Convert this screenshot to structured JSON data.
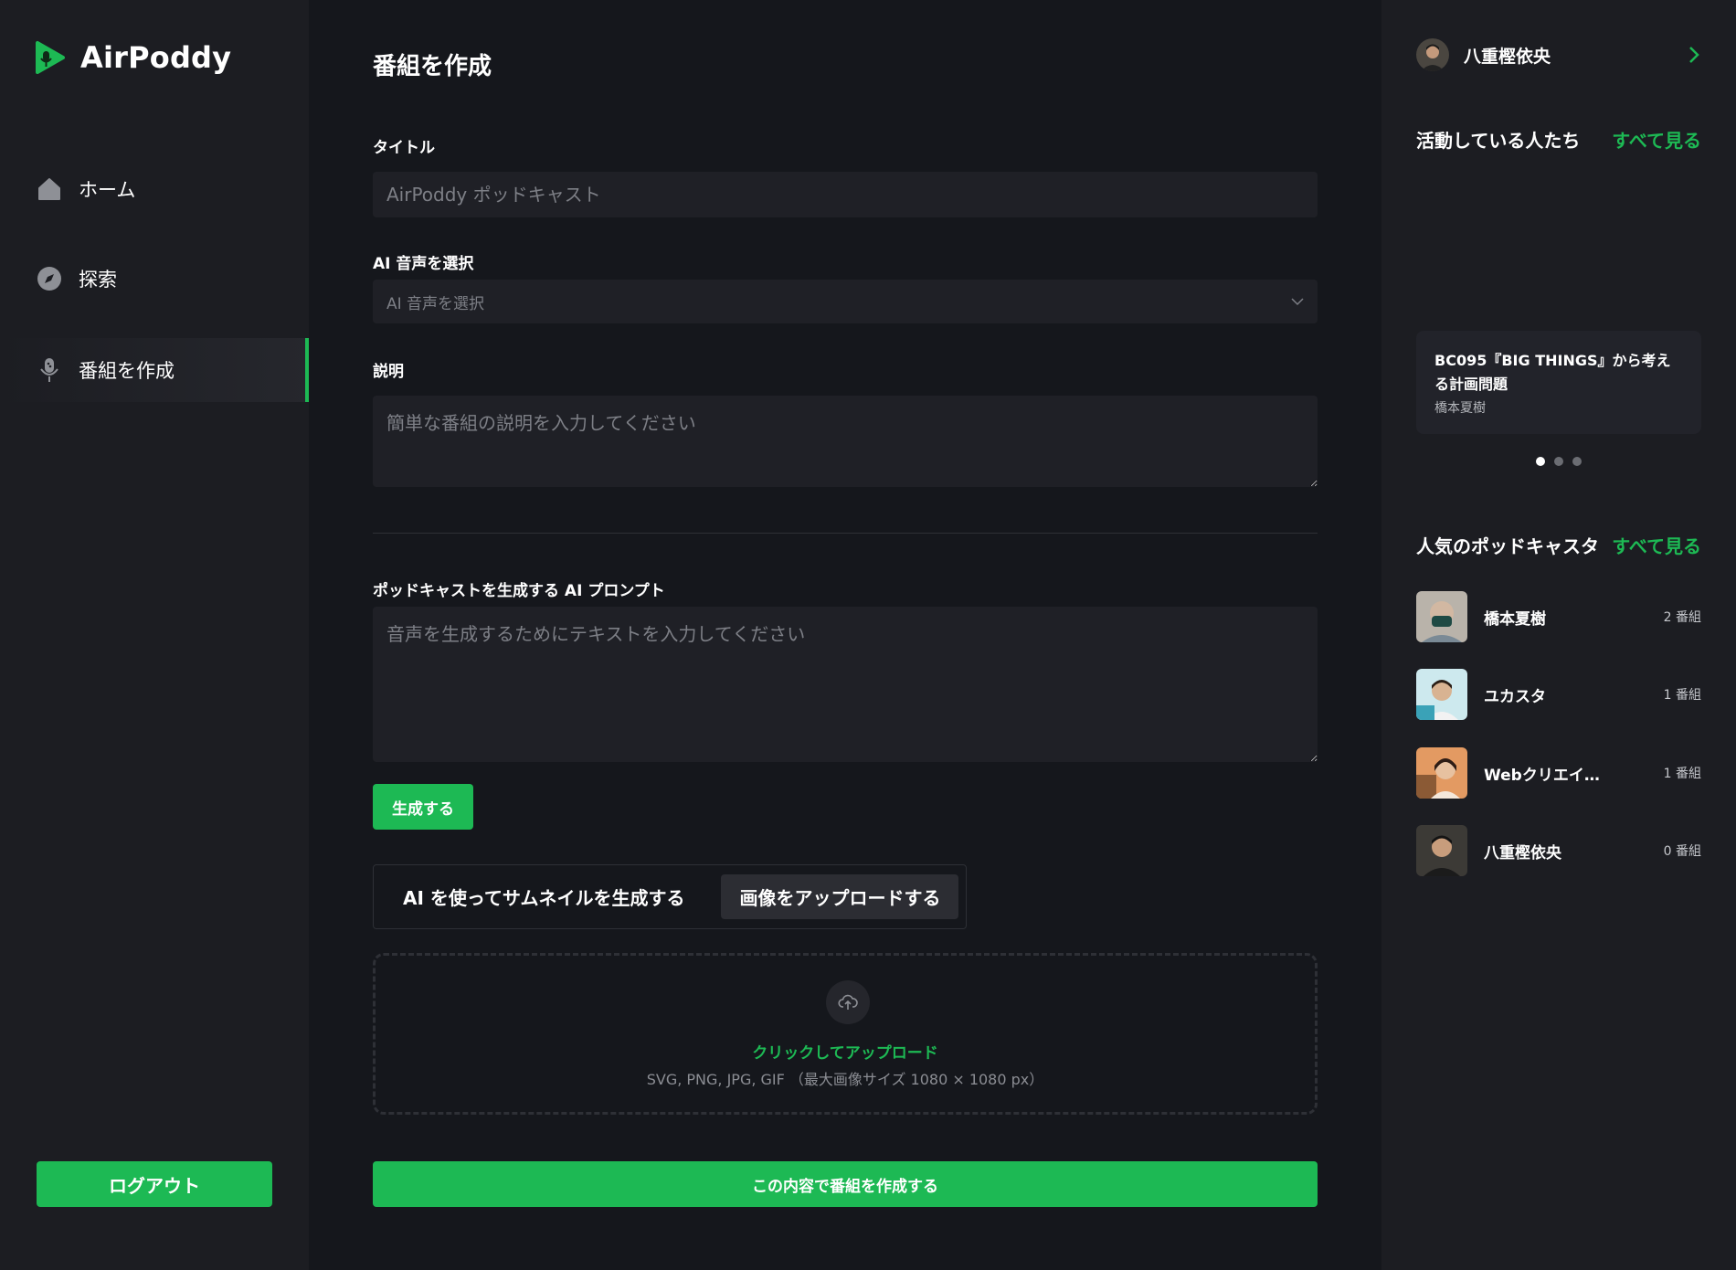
{
  "app": {
    "name": "AirPoddy"
  },
  "colors": {
    "accent": "#1db954",
    "background": "#15171c",
    "sidebar": "#1c1d22",
    "input": "#1f2026"
  },
  "nav": {
    "items": [
      {
        "label": "ホーム",
        "icon": "home-icon",
        "active": false
      },
      {
        "label": "探索",
        "icon": "compass-icon",
        "active": false
      },
      {
        "label": "番組を作成",
        "icon": "microphone-icon",
        "active": true
      }
    ],
    "logout_label": "ログアウト"
  },
  "form": {
    "page_title": "番組を作成",
    "title_label": "タイトル",
    "title_placeholder": "AirPoddy ポッドキャスト",
    "voice_label": "AI 音声を選択",
    "voice_placeholder": "AI 音声を選択",
    "description_label": "説明",
    "description_placeholder": "簡単な番組の説明を入力してください",
    "prompt_label": "ポッドキャストを生成する AI プロンプト",
    "prompt_placeholder": "音声を生成するためにテキストを入力してください",
    "generate_label": "生成する",
    "thumbnail_tabs": [
      {
        "label": "AI を使ってサムネイルを生成する",
        "active": false
      },
      {
        "label": "画像をアップロードする",
        "active": true
      }
    ],
    "upload_link": "クリックしてアップロード",
    "upload_hint": "SVG, PNG, JPG, GIF （最大画像サイズ 1080 × 1080 px）",
    "submit_label": "この内容で番組を作成する"
  },
  "right": {
    "user": {
      "name": "八重樫依央"
    },
    "active_title": "活動している人たち",
    "see_all": "すべて見る",
    "featured": {
      "title": "BC095『BIG THINGS』から考える計画問題",
      "author": "橋本夏樹"
    },
    "carousel": {
      "count": 3,
      "active_index": 0
    },
    "popular_title": "人気のポッドキャスタ",
    "podcasters": [
      {
        "name": "橋本夏樹",
        "count": "2 番組"
      },
      {
        "name": "ユカスタ",
        "count": "1 番組"
      },
      {
        "name": "Webクリエイ…",
        "count": "1 番組"
      },
      {
        "name": "八重樫依央",
        "count": "0 番組"
      }
    ]
  }
}
